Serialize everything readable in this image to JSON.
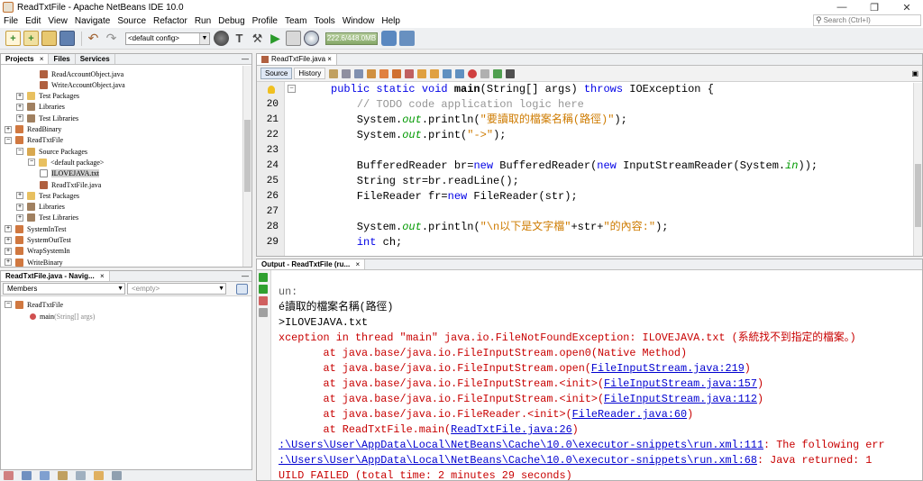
{
  "window": {
    "title": "ReadTxtFile - Apache NetBeans IDE 10.0",
    "min": "—",
    "max": "❐",
    "close": "✕"
  },
  "menu": [
    "File",
    "Edit",
    "View",
    "Navigate",
    "Source",
    "Refactor",
    "Run",
    "Debug",
    "Profile",
    "Team",
    "Tools",
    "Window",
    "Help"
  ],
  "search": {
    "placeholder": "Search (Ctrl+I)"
  },
  "toolbar": {
    "config": "<default config>",
    "memory": "222.6/448.0MB"
  },
  "projects_panel": {
    "tabs": [
      "Projects",
      "Files",
      "Services"
    ],
    "tree": [
      {
        "label": "ReadAccountObject.java",
        "indent": 3,
        "icon": "java",
        "exp": ""
      },
      {
        "label": "WriteAccountObject.java",
        "indent": 3,
        "icon": "java",
        "exp": ""
      },
      {
        "label": "Test Packages",
        "indent": 1,
        "icon": "pkg",
        "exp": "+"
      },
      {
        "label": "Libraries",
        "indent": 1,
        "icon": "lib",
        "exp": "+"
      },
      {
        "label": "Test Libraries",
        "indent": 1,
        "icon": "lib",
        "exp": "+"
      },
      {
        "label": "ReadBinary",
        "indent": 0,
        "icon": "proj",
        "exp": "+"
      },
      {
        "label": "ReadTxtFile",
        "indent": 0,
        "icon": "proj",
        "exp": "−"
      },
      {
        "label": "Source Packages",
        "indent": 1,
        "icon": "src",
        "exp": "−"
      },
      {
        "label": "<default package>",
        "indent": 2,
        "icon": "pkg",
        "exp": "−"
      },
      {
        "label": "ILOVEJAVA.txt",
        "indent": 3,
        "icon": "txt",
        "exp": "",
        "selected": true
      },
      {
        "label": "ReadTxtFile.java",
        "indent": 3,
        "icon": "java",
        "exp": ""
      },
      {
        "label": "Test Packages",
        "indent": 1,
        "icon": "pkg",
        "exp": "+"
      },
      {
        "label": "Libraries",
        "indent": 1,
        "icon": "lib",
        "exp": "+"
      },
      {
        "label": "Test Libraries",
        "indent": 1,
        "icon": "lib",
        "exp": "+"
      },
      {
        "label": "SystemInTest",
        "indent": 0,
        "icon": "proj",
        "exp": "+"
      },
      {
        "label": "SystemOutTest",
        "indent": 0,
        "icon": "proj",
        "exp": "+"
      },
      {
        "label": "WrapSystemIn",
        "indent": 0,
        "icon": "proj",
        "exp": "+"
      },
      {
        "label": "WriteBinary",
        "indent": 0,
        "icon": "proj",
        "exp": "+"
      }
    ]
  },
  "navigator": {
    "tab": "ReadTxtFile.java - Navig...",
    "members_label": "Members",
    "filter": "<empty>",
    "class_name": "ReadTxtFile",
    "method": "main",
    "method_params": "(String[] args)"
  },
  "editor": {
    "tab": "ReadTxtFile.java",
    "source_label": "Source",
    "history_label": "History",
    "lines": [
      {
        "num": "",
        "html": "<span class=\"kw\">public static void</span> <b>main</b>(String[] args) <span class=\"kw\">throws</span> IOException {"
      },
      {
        "num": "20",
        "html": "    <span class=\"cm\">// TODO code application logic here</span>"
      },
      {
        "num": "21",
        "html": "    System.<span class=\"it\">out</span>.println(<span class=\"st\">\"要讀取的檔案名稱(路徑)\"</span>);"
      },
      {
        "num": "22",
        "html": "    System.<span class=\"it\">out</span>.print(<span class=\"st\">\"->\"</span>);"
      },
      {
        "num": "23",
        "html": ""
      },
      {
        "num": "24",
        "html": "    BufferedReader br=<span class=\"kw\">new</span> BufferedReader(<span class=\"kw\">new</span> InputStreamReader(System.<span class=\"it\">in</span>));"
      },
      {
        "num": "25",
        "html": "    String str=br.readLine();"
      },
      {
        "num": "26",
        "html": "    FileReader fr=<span class=\"kw\">new</span> FileReader(str);"
      },
      {
        "num": "27",
        "html": ""
      },
      {
        "num": "28",
        "html": "    System.<span class=\"it\">out</span>.println(<span class=\"st\">\"\\n以下是文字檔\"</span>+str+<span class=\"st\">\"的內容:\"</span>);"
      },
      {
        "num": "29",
        "html": "    <span class=\"kw\">int</span> ch;"
      }
    ]
  },
  "output": {
    "tab": "Output - ReadTxtFile (ru...",
    "lines": [
      {
        "cls": "o-gray",
        "text": "un:"
      },
      {
        "cls": "o-black",
        "text": "é讀取的檔案名稱(路徑)"
      },
      {
        "cls": "o-black",
        "text": ">ILOVEJAVA.txt"
      },
      {
        "cls": "o-red",
        "text": "xception in thread \"main\" java.io.FileNotFoundException: ILOVEJAVA.txt (系統找不到指定的檔案。)"
      },
      {
        "cls": "o-red",
        "pre": "       at java.base/java.io.FileInputStream.open0(Native Method)",
        "link": "",
        "post": ""
      },
      {
        "cls": "o-red",
        "pre": "       at java.base/java.io.FileInputStream.open(",
        "link": "FileInputStream.java:219",
        "post": ")"
      },
      {
        "cls": "o-red",
        "pre": "       at java.base/java.io.FileInputStream.<init>(",
        "link": "FileInputStream.java:157",
        "post": ")"
      },
      {
        "cls": "o-red",
        "pre": "       at java.base/java.io.FileInputStream.<init>(",
        "link": "FileInputStream.java:112",
        "post": ")"
      },
      {
        "cls": "o-red",
        "pre": "       at java.base/java.io.FileReader.<init>(",
        "link": "FileReader.java:60",
        "post": ")"
      },
      {
        "cls": "o-red",
        "pre": "       at ReadTxtFile.main(",
        "link": "ReadTxtFile.java:26",
        "post": ")"
      },
      {
        "cls": "o-red",
        "pre": "",
        "link": ":\\Users\\User\\AppData\\Local\\NetBeans\\Cache\\10.0\\executor-snippets\\run.xml:111",
        "post": ": The following err"
      },
      {
        "cls": "o-red",
        "pre": "",
        "link": ":\\Users\\User\\AppData\\Local\\NetBeans\\Cache\\10.0\\executor-snippets\\run.xml:68",
        "post": ": Java returned: 1"
      },
      {
        "cls": "o-red",
        "text": "UILD FAILED (total time: 2 minutes 29 seconds)"
      }
    ]
  }
}
